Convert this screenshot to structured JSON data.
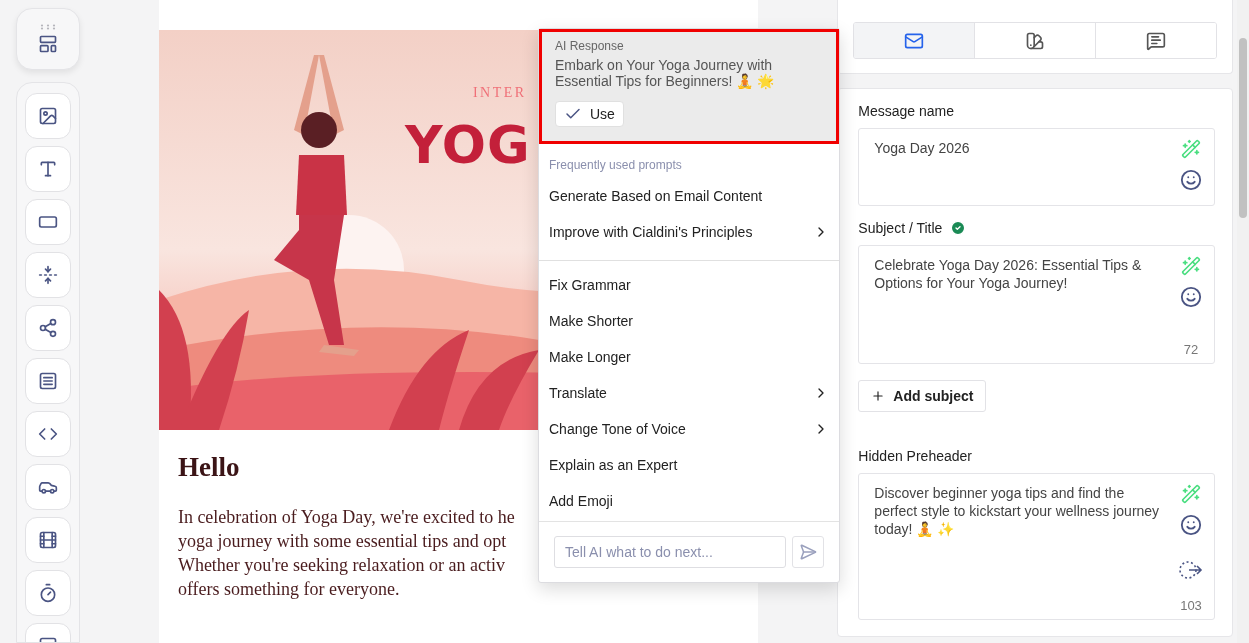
{
  "toolbar": {
    "tools": [
      {
        "kind": "image"
      },
      {
        "kind": "text"
      },
      {
        "kind": "button"
      },
      {
        "kind": "spacer"
      },
      {
        "kind": "social"
      },
      {
        "kind": "divider"
      },
      {
        "kind": "html"
      },
      {
        "kind": "menu"
      },
      {
        "kind": "video"
      },
      {
        "kind": "timer"
      },
      {
        "kind": "more"
      }
    ]
  },
  "email": {
    "hero": {
      "eyebrow": "INTER",
      "title": "YOG"
    },
    "heading": "Hello",
    "body_lines": [
      "In celebration of Yoga Day, we're excited to he",
      "yoga journey with some essential tips and opt",
      "Whether you're seeking relaxation or an activ",
      "offers something for everyone."
    ]
  },
  "ai_popup": {
    "response": {
      "label": "AI Response",
      "text": "Embark on Your Yoga Journey with Essential Tips for Beginners! 🧘 🌟",
      "use_button": "Use"
    },
    "prompts": {
      "heading": "Frequently used prompts",
      "items": [
        {
          "label": "Generate Based on Email Content",
          "submenu": false
        },
        {
          "label": "Improve with Cialdini's Principles",
          "submenu": true
        }
      ]
    },
    "actions": [
      {
        "label": "Fix Grammar",
        "submenu": false
      },
      {
        "label": "Make Shorter",
        "submenu": false
      },
      {
        "label": "Make Longer",
        "submenu": false
      },
      {
        "label": "Translate",
        "submenu": true
      },
      {
        "label": "Change Tone of Voice",
        "submenu": true
      },
      {
        "label": "Explain as an Expert",
        "submenu": false
      },
      {
        "label": "Add Emoji",
        "submenu": false
      }
    ],
    "input": {
      "placeholder": "Tell AI what to do next..."
    }
  },
  "settings": {
    "tabs": [
      {
        "kind": "envelope",
        "selected": true
      },
      {
        "kind": "design",
        "selected": false
      },
      {
        "kind": "comment",
        "selected": false
      }
    ],
    "message_name": {
      "label": "Message name",
      "value": "Yoga Day 2026"
    },
    "subject": {
      "label": "Subject / Title",
      "verified": true,
      "value": "Celebrate Yoga Day 2026: Essential Tips & Options for Your Yoga Journey!",
      "count": "72"
    },
    "add_subject": "Add subject",
    "preheader": {
      "label": "Hidden Preheader",
      "value": "Discover beginner yoga tips and find the perfect style to kickstart your wellness journey today! 🧘 ✨",
      "count": "103"
    }
  }
}
